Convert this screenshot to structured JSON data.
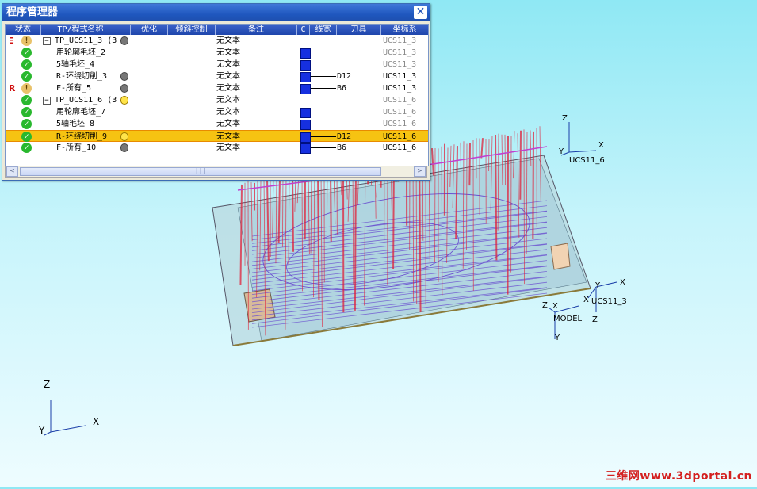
{
  "program_manager": {
    "title": "程序管理器",
    "close_symbol": "✕",
    "columns": [
      "状态",
      "TP/程式名称",
      "优化",
      "倾斜控制",
      "备注",
      "C",
      "线宽",
      "刀具",
      "坐标系"
    ],
    "rows": [
      {
        "flag": "Ξ",
        "status": "warn",
        "expander": "−",
        "name": "TP_UCS11_3 (3",
        "bulb": "gray",
        "note": "无文本",
        "cbox": false,
        "tool": "",
        "ucs": "UCS11_3",
        "ucs_bold": false
      },
      {
        "flag": "",
        "status": "ok",
        "expander": "",
        "name": "用轮廓毛坯_2",
        "bulb": "",
        "note": "无文本",
        "cbox": true,
        "tool": "",
        "ucs": "UCS11_3",
        "ucs_bold": false
      },
      {
        "flag": "",
        "status": "ok",
        "expander": "",
        "name": "5轴毛坯_4",
        "bulb": "",
        "note": "无文本",
        "cbox": true,
        "tool": "",
        "ucs": "UCS11_3",
        "ucs_bold": false
      },
      {
        "flag": "",
        "status": "ok",
        "expander": "",
        "name": "R-环绕切削_3",
        "bulb": "gray",
        "note": "无文本",
        "cbox": true,
        "tool": "D12",
        "ucs": "UCS11_3",
        "ucs_bold": true
      },
      {
        "flag": "R",
        "status": "warn",
        "expander": "",
        "name": "F-所有_5",
        "bulb": "gray",
        "note": "无文本",
        "cbox": true,
        "tool": "B6",
        "ucs": "UCS11_3",
        "ucs_bold": true
      },
      {
        "flag": "",
        "status": "ok",
        "expander": "−",
        "name": "TP_UCS11_6 (3",
        "bulb": "yellow",
        "note": "无文本",
        "cbox": false,
        "tool": "",
        "ucs": "UCS11_6",
        "ucs_bold": false
      },
      {
        "flag": "",
        "status": "ok",
        "expander": "",
        "name": "用轮廓毛坯_7",
        "bulb": "",
        "note": "无文本",
        "cbox": true,
        "tool": "",
        "ucs": "UCS11_6",
        "ucs_bold": false
      },
      {
        "flag": "",
        "status": "ok",
        "expander": "",
        "name": "5轴毛坯_8",
        "bulb": "",
        "note": "无文本",
        "cbox": true,
        "tool": "",
        "ucs": "UCS11_6",
        "ucs_bold": false
      },
      {
        "flag": "",
        "status": "ok",
        "expander": "",
        "name": "R-环绕切削_9",
        "bulb": "yellow",
        "note": "无文本",
        "cbox": true,
        "tool": "D12",
        "ucs": "UCS11_6",
        "ucs_bold": true,
        "selected": true
      },
      {
        "flag": "",
        "status": "ok",
        "expander": "",
        "name": "F-所有_10",
        "bulb": "gray",
        "note": "无文本",
        "cbox": true,
        "tool": "B6",
        "ucs": "UCS11_6",
        "ucs_bold": true
      }
    ],
    "scroll": {
      "left": "<",
      "right": ">",
      "grip": "|||"
    }
  },
  "viewport": {
    "axes_labels": {
      "z": "Z",
      "x": "X",
      "y": "Y"
    },
    "ucs11_6_label": "UCS11_6",
    "ucs11_3_label": "UCS11_3",
    "model_label": "MODEL"
  },
  "watermark": "三维网www.3dportal.cn",
  "colors": {
    "toolpath_red": "#e0203a",
    "toolpath_purple": "#6a4fd0",
    "stock_fill": "#b9d9e0",
    "selected_row": "#f6c312"
  }
}
